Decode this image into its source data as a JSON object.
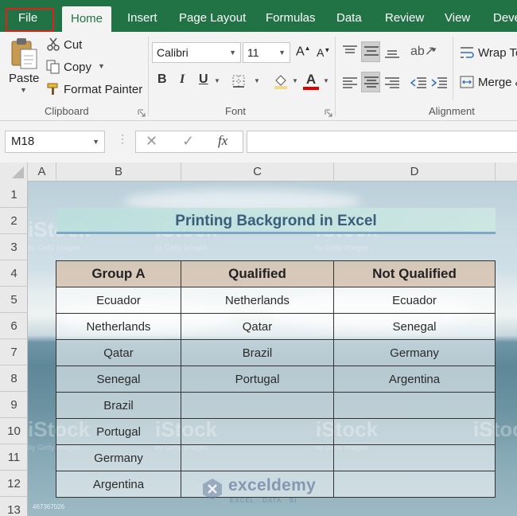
{
  "ribbon": {
    "tabs": [
      "File",
      "Home",
      "Insert",
      "Page Layout",
      "Formulas",
      "Data",
      "Review",
      "View",
      "Deve"
    ],
    "active_tab": "Home",
    "clipboard": {
      "paste": "Paste",
      "cut": "Cut",
      "copy": "Copy",
      "format_painter": "Format Painter",
      "label": "Clipboard"
    },
    "font": {
      "name": "Calibri",
      "size": "11",
      "bold": "B",
      "italic": "I",
      "underline": "U",
      "label": "Font",
      "font_color": "#e00000"
    },
    "alignment": {
      "wrap_text": "Wrap Te",
      "merge": "Merge &",
      "label": "Alignment"
    }
  },
  "formula_bar": {
    "name_box": "M18",
    "fx": "fx",
    "formula": ""
  },
  "columns": [
    "A",
    "B",
    "C",
    "D"
  ],
  "rows": [
    "1",
    "2",
    "3",
    "4",
    "5",
    "6",
    "7",
    "8",
    "9",
    "10",
    "11",
    "12",
    "13"
  ],
  "sheet": {
    "title": "Printing Backgrond in Excel",
    "headers": [
      "Group A",
      "Qualified",
      "Not Qualified"
    ],
    "rows": [
      [
        "Ecuador",
        "Netherlands",
        "Ecuador"
      ],
      [
        "Netherlands",
        "Qatar",
        "Senegal"
      ],
      [
        "Qatar",
        "Brazil",
        "Germany"
      ],
      [
        "Senegal",
        "Portugal",
        "Argentina"
      ],
      [
        "Brazil",
        "",
        ""
      ],
      [
        "Portugal",
        "",
        ""
      ],
      [
        "Germany",
        "",
        ""
      ],
      [
        "Argentina",
        "",
        ""
      ]
    ],
    "watermark": "iStock",
    "watermark_sub": "by Getty Images",
    "stock_id": "467367026",
    "logo_name": "exceldemy",
    "logo_tagline": "EXCEL · DATA · BI"
  }
}
